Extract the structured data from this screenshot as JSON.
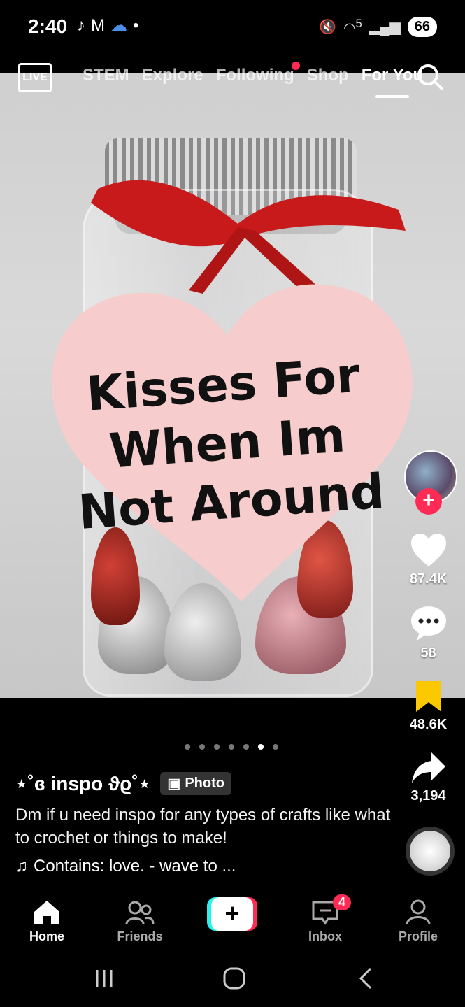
{
  "status_bar": {
    "time": "2:40",
    "battery": "66",
    "signal": "5"
  },
  "top_nav": {
    "live_label": "LIVE",
    "tabs": [
      "STEM",
      "Explore",
      "Following",
      "Shop",
      "For You"
    ],
    "active_tab": "For You"
  },
  "post": {
    "photo_text": "Kisses For When Im Not Around",
    "author": "⋆˚ɞ inspo ϑϱ˚⋆",
    "type_badge": "Photo",
    "description": "Dm if u need inspo for any types of crafts like what to crochet or things to make!",
    "music": "Contains: love. - wave to ...",
    "page_count": 7,
    "current_page": 6
  },
  "actions": {
    "likes": "87.4K",
    "comments": "58",
    "saves": "48.6K",
    "shares": "3,194"
  },
  "bottom_nav": {
    "home": "Home",
    "friends": "Friends",
    "inbox": "Inbox",
    "inbox_badge": "4",
    "profile": "Profile"
  },
  "colors": {
    "accent": "#fe2c55",
    "save": "#fcc800",
    "background": "#000000"
  }
}
